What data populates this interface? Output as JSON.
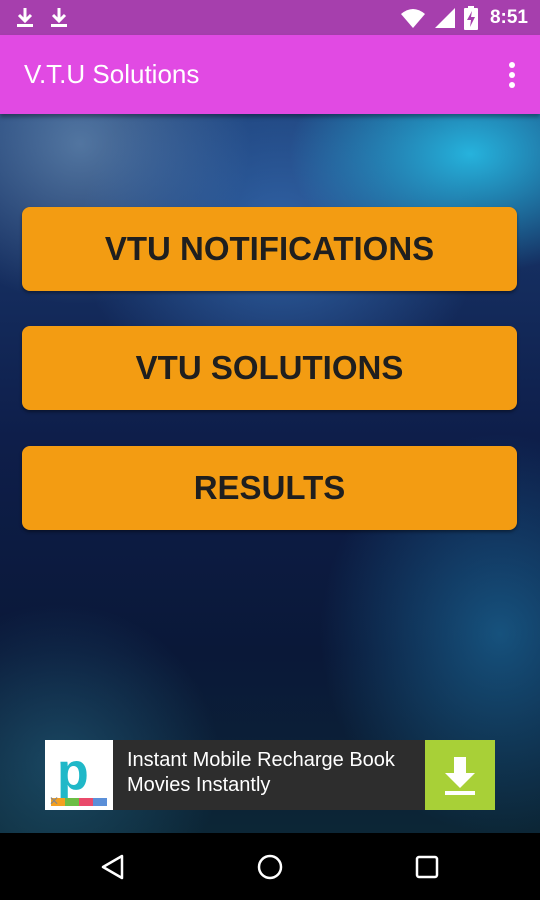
{
  "status_bar": {
    "time": "8:51",
    "icons": [
      "download-icon",
      "download-icon",
      "wifi-icon",
      "cellular-signal-icon",
      "battery-charging-icon"
    ]
  },
  "app_bar": {
    "title": "V.T.U Solutions",
    "overflow_icon": "more-vert-icon"
  },
  "menu": {
    "buttons": [
      {
        "label": "VTU NOTIFICATIONS"
      },
      {
        "label": "VTU SOLUTIONS"
      },
      {
        "label": "RESULTS"
      }
    ]
  },
  "ad": {
    "logo_letter": "p",
    "text": "Instant Mobile Recharge Book Movies Instantly",
    "action_icon": "download-icon"
  },
  "nav_bar": {
    "icons": [
      "back-icon",
      "home-icon",
      "recents-icon"
    ]
  },
  "colors": {
    "app_bar": "#e14ae3",
    "status_bar": "#a63fad",
    "button": "#f39c12",
    "ad_action": "#a8d037"
  }
}
